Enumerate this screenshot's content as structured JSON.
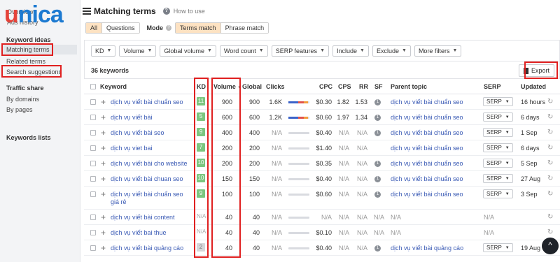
{
  "logo": {
    "first": "u",
    "rest": "nica",
    "behind_text": "Overview"
  },
  "sidebar": {
    "overview": "Overview",
    "ads_history": "Ads history",
    "keyword_ideas": "Keyword ideas",
    "matching_terms": "Matching terms",
    "related_terms": "Related terms",
    "search_suggestions": "Search suggestions",
    "traffic_share": "Traffic share",
    "by_domains": "By domains",
    "by_pages": "By pages",
    "keywords_lists": "Keywords lists"
  },
  "header": {
    "title": "Matching terms",
    "howto": "How to use",
    "help": "?"
  },
  "scope": {
    "all": "All",
    "questions": "Questions"
  },
  "mode": {
    "label": "Mode",
    "terms": "Terms match",
    "phrase": "Phrase match"
  },
  "filters": [
    "KD",
    "Volume",
    "Global volume",
    "Word count",
    "SERP features",
    "Include",
    "Exclude",
    "More filters"
  ],
  "count": "36 keywords",
  "export": "Export",
  "columns": {
    "keyword": "Keyword",
    "kd": "KD",
    "volume": "Volume",
    "global": "Global",
    "clicks": "Clicks",
    "cpc": "CPC",
    "cps": "CPS",
    "rr": "RR",
    "sf": "SF",
    "parent": "Parent topic",
    "serp": "SERP",
    "updated": "Updated"
  },
  "rows": [
    {
      "keyword": "dịch vụ viết bài chuẩn seo",
      "kd": "11",
      "kd_style": "g",
      "volume": "900",
      "global": "900",
      "clicks": "1.6K",
      "spark": "full",
      "cpc": "$0.30",
      "cps": "1.82",
      "rr": "1.53",
      "sf": "1",
      "parent": "dịch vụ viết bài chuẩn seo",
      "serp": "SERP",
      "updated": "16 hours"
    },
    {
      "keyword": "dịch vụ viết bài",
      "kd": "5",
      "kd_style": "g",
      "volume": "600",
      "global": "600",
      "clicks": "1.2K",
      "spark": "full",
      "cpc": "$0.60",
      "cps": "1.97",
      "rr": "1.34",
      "sf": "1",
      "parent": "dịch vụ viết bài chuẩn seo",
      "serp": "SERP",
      "updated": "6 days"
    },
    {
      "keyword": "dịch vụ viết bài seo",
      "kd": "9",
      "kd_style": "g",
      "volume": "400",
      "global": "400",
      "clicks": "N/A",
      "spark": "empty",
      "cpc": "$0.40",
      "cps": "N/A",
      "rr": "N/A",
      "sf": "1",
      "parent": "dịch vụ viết bài chuẩn seo",
      "serp": "SERP",
      "updated": "1 Sep"
    },
    {
      "keyword": "dịch vụ viet bai",
      "kd": "7",
      "kd_style": "g",
      "volume": "200",
      "global": "200",
      "clicks": "N/A",
      "spark": "empty",
      "cpc": "$1.40",
      "cps": "N/A",
      "rr": "N/A",
      "sf": "",
      "parent": "dịch vụ viết bài chuẩn seo",
      "serp": "SERP",
      "updated": "6 days"
    },
    {
      "keyword": "dịch vụ viết bài cho website",
      "kd": "10",
      "kd_style": "g",
      "volume": "200",
      "global": "200",
      "clicks": "N/A",
      "spark": "empty",
      "cpc": "$0.35",
      "cps": "N/A",
      "rr": "N/A",
      "sf": "1",
      "parent": "dịch vụ viết bài chuẩn seo",
      "serp": "SERP",
      "updated": "5 Sep"
    },
    {
      "keyword": "dịch vụ viết bài chuan seo",
      "kd": "10",
      "kd_style": "g",
      "volume": "150",
      "global": "150",
      "clicks": "N/A",
      "spark": "empty",
      "cpc": "$0.40",
      "cps": "N/A",
      "rr": "N/A",
      "sf": "1",
      "parent": "dịch vụ viết bài chuẩn seo",
      "serp": "SERP",
      "updated": "27 Aug"
    },
    {
      "keyword": "dịch vụ viết bài chuẩn seo giá rẻ",
      "kd": "9",
      "kd_style": "g",
      "volume": "100",
      "global": "100",
      "clicks": "N/A",
      "spark": "empty",
      "cpc": "$0.60",
      "cps": "N/A",
      "rr": "N/A",
      "sf": "1",
      "parent": "dịch vụ viết bài chuẩn seo",
      "serp": "SERP",
      "updated": "3 Sep"
    },
    {
      "keyword": "dịch vụ viết bài content",
      "kd": "N/A",
      "kd_style": "na",
      "volume": "40",
      "global": "40",
      "clicks": "N/A",
      "spark": "empty",
      "cpc": "N/A",
      "cps": "N/A",
      "rr": "N/A",
      "sf": "N/A",
      "parent": "N/A",
      "serp": "N/A",
      "updated": ""
    },
    {
      "keyword": "dịch vụ viết bai thue",
      "kd": "N/A",
      "kd_style": "na",
      "volume": "40",
      "global": "40",
      "clicks": "N/A",
      "spark": "empty",
      "cpc": "$0.10",
      "cps": "N/A",
      "rr": "N/A",
      "sf": "N/A",
      "parent": "N/A",
      "serp": "N/A",
      "updated": ""
    },
    {
      "keyword": "dịch vụ viết bài quảng cáo",
      "kd": "2",
      "kd_style": "l",
      "volume": "40",
      "global": "40",
      "clicks": "N/A",
      "spark": "empty",
      "cpc": "$0.40",
      "cps": "N/A",
      "rr": "N/A",
      "sf": "1",
      "parent": "dịch vụ viết bài quảng cáo",
      "serp": "SERP",
      "updated": "19 Aug"
    }
  ],
  "colors": {
    "accent_red": "#e02020",
    "kd_green": "#7cc67f",
    "link": "#3b5bb5"
  }
}
